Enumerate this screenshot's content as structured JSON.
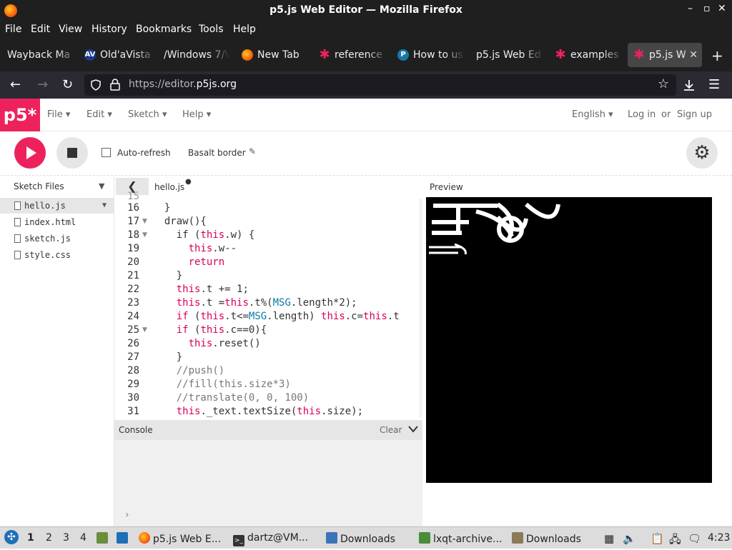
{
  "window": {
    "title": "p5.js Web Editor — Mozilla Firefox",
    "controls": [
      "–",
      "▫",
      "✕"
    ]
  },
  "menubar": [
    "File",
    "Edit",
    "View",
    "History",
    "Bookmarks",
    "Tools",
    "Help"
  ],
  "tabs": [
    {
      "label": "Wayback Ma",
      "icon": "none"
    },
    {
      "label": "Old'aVista",
      "icon": "altavista-icon",
      "glyph": "AV"
    },
    {
      "label": "/Windows 7/V",
      "icon": "none"
    },
    {
      "label": "New Tab",
      "icon": "firefox-icon"
    },
    {
      "label": "reference",
      "icon": "p5-asterisk-icon"
    },
    {
      "label": "How to us",
      "icon": "p-icon",
      "glyph": "P"
    },
    {
      "label": "p5.js Web Ed",
      "icon": "none"
    },
    {
      "label": "examples",
      "icon": "p5-asterisk-icon"
    },
    {
      "label": "p5.js W",
      "icon": "p5-asterisk-icon",
      "active": true
    }
  ],
  "navbar": {
    "url_prefix": "https://editor.",
    "url_domain": "p5js.org"
  },
  "p5": {
    "logo": "p5*",
    "menus": [
      "File",
      "Edit",
      "Sketch",
      "Help"
    ],
    "language": "English",
    "login": "Log in",
    "or": "or",
    "signup": "Sign up",
    "auto_refresh": "Auto-refresh",
    "sketch_name": "Basalt border",
    "sketch_files": "Sketch Files",
    "files": [
      "hello.js",
      "index.html",
      "sketch.js",
      "style.css"
    ],
    "tab_file": "hello.js",
    "preview": "Preview",
    "console": "Console",
    "clear": "Clear",
    "console_prompt": "›"
  },
  "code": {
    "first_line_partial": "15",
    "lines": [
      {
        "n": "16",
        "fold": false,
        "html": "  }"
      },
      {
        "n": "17",
        "fold": true,
        "html": "  draw(){"
      },
      {
        "n": "18",
        "fold": true,
        "html": "    if (<span class='kw'>this</span>.w) {"
      },
      {
        "n": "19",
        "fold": false,
        "html": "      <span class='kw'>this</span>.w--"
      },
      {
        "n": "20",
        "fold": false,
        "html": "      <span class='kw'>return</span>"
      },
      {
        "n": "21",
        "fold": false,
        "html": "    }"
      },
      {
        "n": "22",
        "fold": false,
        "html": "    <span class='kw'>this</span>.t += 1;"
      },
      {
        "n": "23",
        "fold": false,
        "html": "    <span class='kw'>this</span>.t =<span class='kw'>this</span>.t%(<span class='cs'>MSG</span>.length*2);"
      },
      {
        "n": "24",
        "fold": false,
        "html": "    <span class='kw'>if</span> (<span class='kw'>this</span>.t&lt;=<span class='cs'>MSG</span>.length) <span class='kw'>this</span>.c=<span class='kw'>this</span>.t"
      },
      {
        "n": "25",
        "fold": true,
        "html": "    <span class='kw'>if</span> (<span class='kw'>this</span>.c==0){"
      },
      {
        "n": "26",
        "fold": false,
        "html": "      <span class='kw'>this</span>.reset()"
      },
      {
        "n": "27",
        "fold": false,
        "html": "    }"
      },
      {
        "n": "28",
        "fold": false,
        "html": "    <span class='cm'>//push()</span>"
      },
      {
        "n": "29",
        "fold": false,
        "html": "    <span class='cm'>//fill(this.size*3)</span>"
      },
      {
        "n": "30",
        "fold": false,
        "html": "    <span class='cm'>//translate(0, 0, 100)</span>"
      },
      {
        "n": "31",
        "fold": false,
        "html": "    <span class='kw'>this</span>._text.textSize(<span class='kw'>this</span>.size);"
      }
    ]
  },
  "taskbar": {
    "workspaces": [
      "1",
      "2",
      "3",
      "4"
    ],
    "apps": [
      {
        "label": "p5.js Web E...",
        "icon": "firefox-icon"
      },
      {
        "label": "dartz@VM...",
        "icon": "terminal-icon"
      },
      {
        "label": "Downloads",
        "icon": "folder-icon"
      },
      {
        "label": "lxqt-archive...",
        "icon": "archive-icon"
      },
      {
        "label": "Downloads",
        "icon": "folder-icon"
      }
    ],
    "time": "4:23"
  },
  "colors": {
    "p5_pink": "#ed225d",
    "firefox_dark": "#1f1f1f",
    "taskbar": "#dcdcdc"
  }
}
